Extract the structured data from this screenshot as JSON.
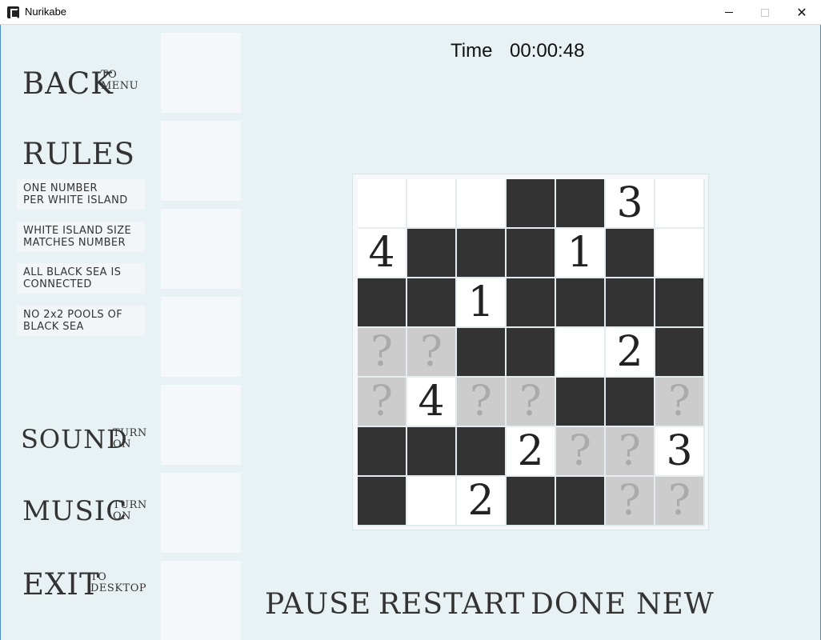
{
  "window": {
    "title": "Nurikabe",
    "minimize": "—",
    "maximize": "□",
    "close": "✕"
  },
  "menu": {
    "back": {
      "label": "BACK",
      "sub1": "TO",
      "sub2": "MENU"
    },
    "rules": {
      "heading": "RULES",
      "items": [
        {
          "line1": "ONE NUMBER",
          "line2": "PER WHITE ISLAND"
        },
        {
          "line1": "WHITE ISLAND SIZE",
          "line2": "MATCHES NUMBER"
        },
        {
          "line1": "ALL BLACK SEA IS",
          "line2": "CONNECTED"
        },
        {
          "line1": "NO 2x2 POOLS OF",
          "line2": "BLACK SEA"
        }
      ]
    },
    "sound": {
      "label": "SOUND",
      "sub1": "TURN",
      "sub2": "ON"
    },
    "music": {
      "label": "MUSIC",
      "sub1": "TURN",
      "sub2": "ON"
    },
    "exit": {
      "label": "EXIT",
      "sub1": "TO",
      "sub2": "DESKTOP"
    }
  },
  "timer": {
    "label": "Time",
    "value": "00:00:48"
  },
  "board": {
    "size": 7,
    "cells": [
      [
        "W",
        "W",
        "W",
        "B",
        "B",
        "3",
        "W"
      ],
      [
        "4",
        "B",
        "B",
        "B",
        "1",
        "B",
        "W"
      ],
      [
        "B",
        "B",
        "1",
        "B",
        "B",
        "B",
        "B"
      ],
      [
        "?",
        "?",
        "B",
        "B",
        "W",
        "2",
        "B"
      ],
      [
        "?",
        "4",
        "?",
        "?",
        "B",
        "B",
        "?"
      ],
      [
        "B",
        "B",
        "B",
        "2",
        "?",
        "?",
        "3"
      ],
      [
        "B",
        "W",
        "2",
        "B",
        "B",
        "?",
        "?"
      ]
    ],
    "unknown_glyph": "?"
  },
  "actions": {
    "pause": "PAUSE",
    "restart": "RESTART",
    "done": "DONE",
    "new": "NEW"
  },
  "colors": {
    "background": "#e8f1f4",
    "black_cell": "#333333",
    "white_cell": "#ffffff",
    "unknown_cell": "#cccccc",
    "text": "#333333"
  }
}
